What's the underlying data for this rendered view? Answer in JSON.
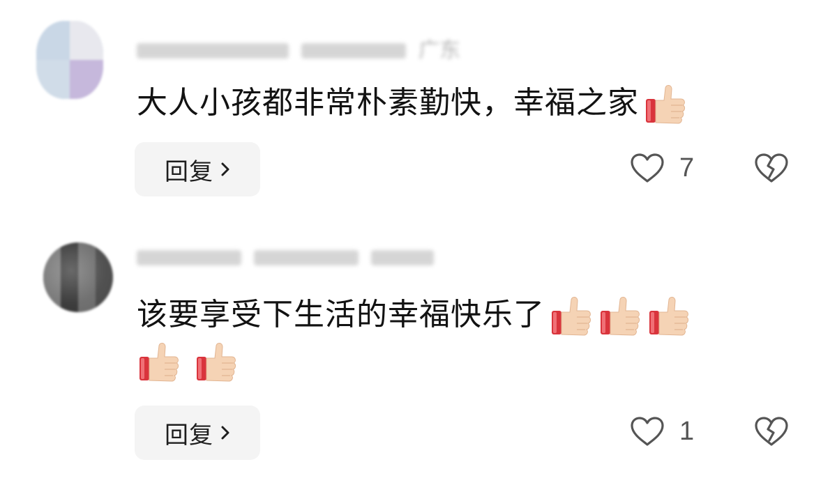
{
  "comments": [
    {
      "location": "广东",
      "text": "大人小孩都非常朴素勤快，幸福之家",
      "emoji_count_inline": 1,
      "reply_label": "回复",
      "like_count": "7"
    },
    {
      "text": "该要享受下生活的幸福快乐了",
      "emoji_count_inline": 3,
      "emoji_count_nextline": 2,
      "reply_label": "回复",
      "like_count": "1"
    }
  ],
  "icons": {
    "thumb": "thumbs-up-emoji",
    "heart": "heart-outline-icon",
    "broken_heart": "broken-heart-icon",
    "chevron": "chevron-right-icon"
  },
  "colors": {
    "reply_bg": "#f4f4f4",
    "icon_stroke": "#555555",
    "sleeve_red": "#d9343c",
    "hand_skin": "#f5d3b5"
  }
}
